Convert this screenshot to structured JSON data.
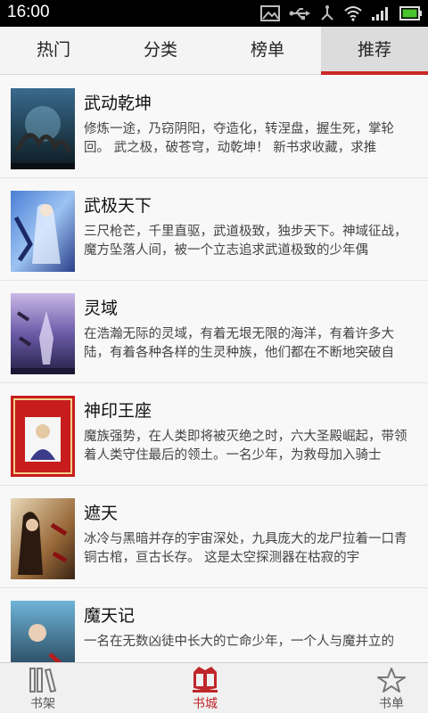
{
  "status_bar": {
    "time": "16:00"
  },
  "tabs": [
    {
      "label": "热门"
    },
    {
      "label": "分类"
    },
    {
      "label": "榜单"
    },
    {
      "label": "推荐"
    }
  ],
  "books": [
    {
      "title": "武动乾坤",
      "description": "修炼一途，乃窃阴阳，夺造化，转涅盘，握生死，掌轮回。 武之极，破苍穹，动乾坤！ 新书求收藏，求推"
    },
    {
      "title": "武极天下",
      "description": "三尺枪芒，千里直驱，武道极致，独步天下。神域征战，魔方坠落人间，被一个立志追求武道极致的少年偶"
    },
    {
      "title": "灵域",
      "description": "在浩瀚无际的灵域，有着无垠无限的海洋，有着许多大陆，有着各种各样的生灵种族，他们都在不断地突破自"
    },
    {
      "title": "神印王座",
      "description": "魔族强势，在人类即将被灭绝之时，六大圣殿崛起，带领着人类守住最后的领土。一名少年，为救母加入骑士"
    },
    {
      "title": "遮天",
      "description": " 冰冷与黑暗并存的宇宙深处，九具庞大的龙尸拉着一口青铜古棺，亘古长存。 这是太空探测器在枯寂的宇"
    },
    {
      "title": "魔天记",
      "description": "一名在无数凶徒中长大的亡命少年，一个人与魔并立的"
    }
  ],
  "bottom_nav": [
    {
      "label": "书架"
    },
    {
      "label": "书城"
    },
    {
      "label": "书单"
    }
  ]
}
